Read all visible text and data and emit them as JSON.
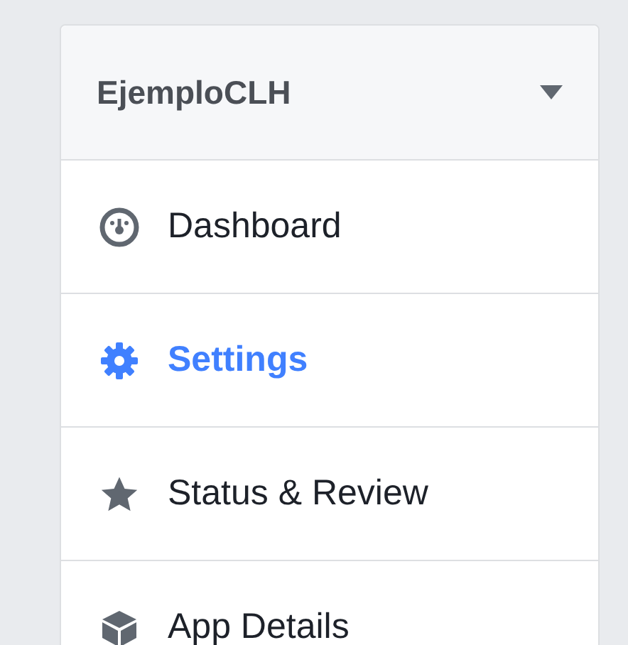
{
  "app_selector": {
    "name": "EjemploCLH",
    "expanded": false
  },
  "menu": [
    {
      "label": "Dashboard",
      "selected": false
    },
    {
      "label": "Settings",
      "selected": true
    },
    {
      "label": "Status & Review",
      "selected": false
    },
    {
      "label": "App Details",
      "selected": false
    }
  ]
}
